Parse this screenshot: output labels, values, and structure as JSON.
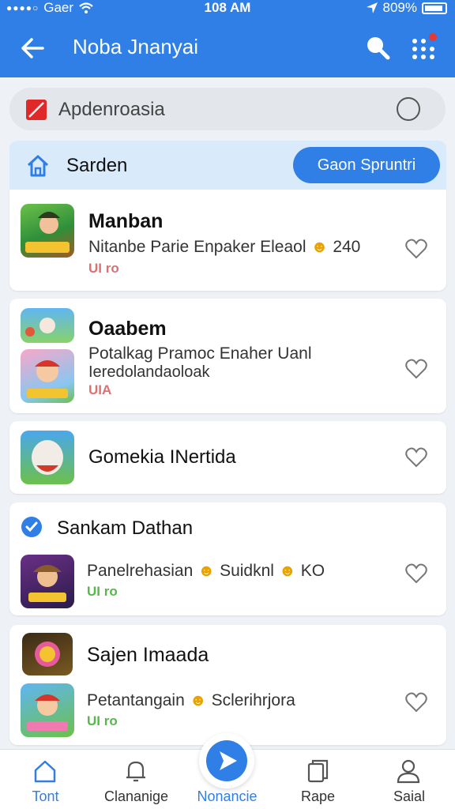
{
  "status": {
    "carrier": "Gaer",
    "time": "108 AM",
    "battery": "809%"
  },
  "appbar": {
    "title": "Noba Jnanyai"
  },
  "search": {
    "text": "Apdenroasia"
  },
  "section": {
    "title": "Sarden",
    "cta": "Gaon Spruntri"
  },
  "items": [
    {
      "name": "Manban",
      "desc": "Nitanbe Parie Enpaker Eleaol",
      "count": "240",
      "tag": "UI ro",
      "tag_color": "#e07070"
    },
    {
      "name": "Oaabem",
      "desc": "Potalkag Pramoc Enaher Uanl",
      "desc2": "Ieredolandaoloak",
      "tag": "UIA",
      "tag_color": "#e07070"
    },
    {
      "name": "Gomekia INertida"
    },
    {
      "name": "Sankam Dathan",
      "desc": "Panelrehasian",
      "desc_b": "Suidknl",
      "count": "KO",
      "tag": "UI ro",
      "tag_color": "#55b94a"
    },
    {
      "name": "Sajen Imaada",
      "desc": "Petantangain",
      "desc_b": "Sclerihrjora",
      "tag": "UI ro",
      "tag_color": "#55b94a"
    }
  ],
  "nav": [
    {
      "label": "Tont",
      "icon": "home-icon",
      "active": true
    },
    {
      "label": "Clananige",
      "icon": "bell-icon"
    },
    {
      "label": "Nonancie",
      "icon": "play-icon",
      "active": true
    },
    {
      "label": "Rape",
      "icon": "copy-icon"
    },
    {
      "label": "Saial",
      "icon": "person-icon"
    }
  ],
  "colors": {
    "primary": "#2f7fe6",
    "section_bg": "#d9ebfb"
  }
}
